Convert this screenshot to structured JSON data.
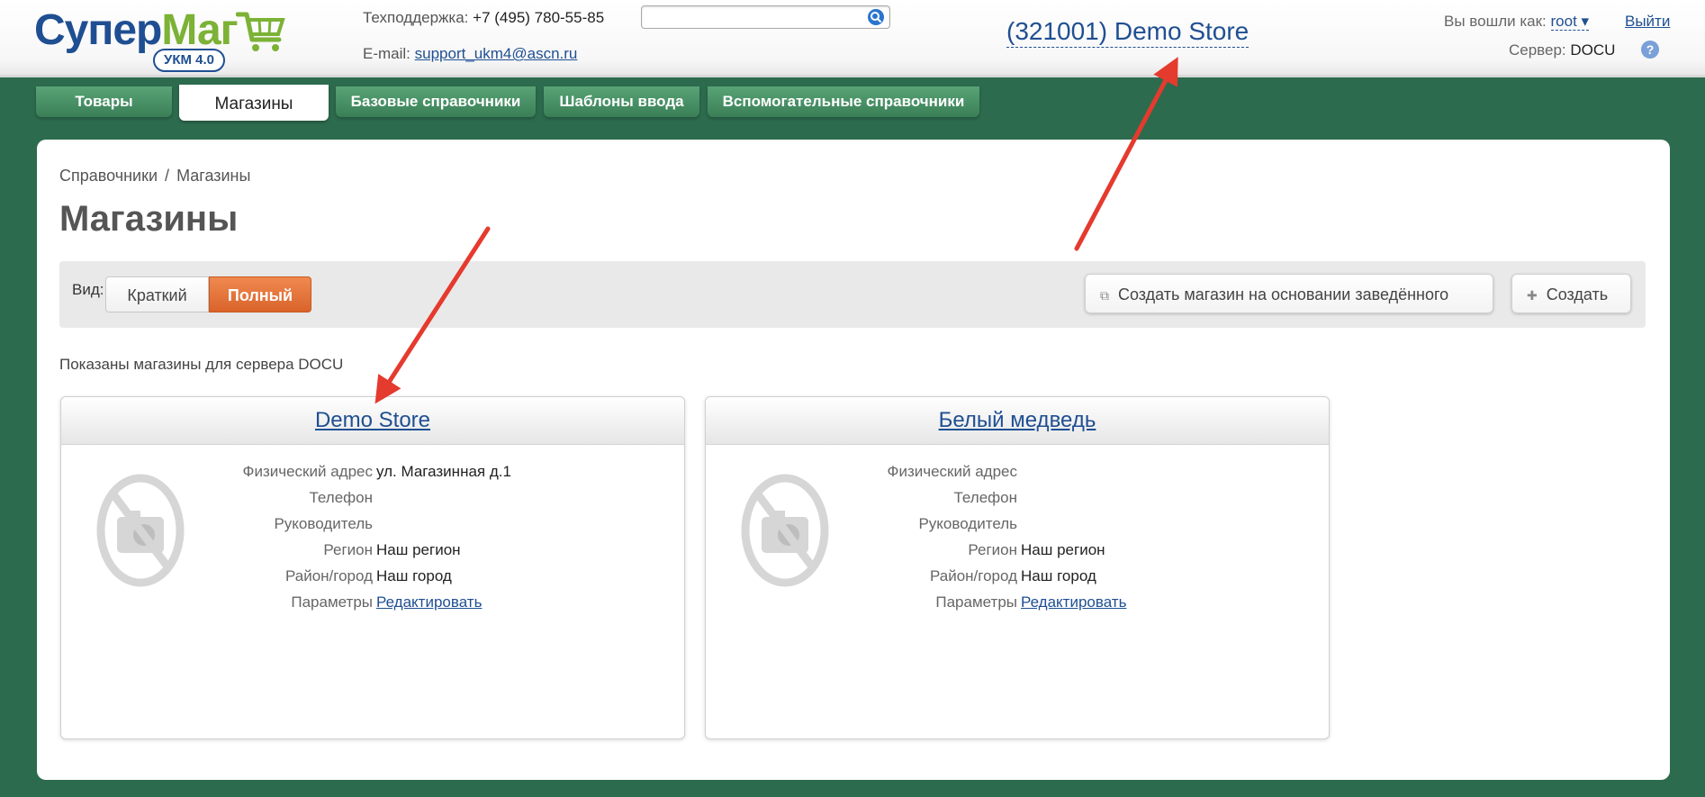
{
  "header": {
    "logo_part1": "Супер",
    "logo_part2": "Маг",
    "logo_badge": "УКМ 4.0",
    "support_label": "Техподдержка:",
    "support_phone": "+7 (495) 780-55-85",
    "email_label": "E-mail:",
    "email_value": "support_ukm4@ascn.ru",
    "search_value": "",
    "store_title": "(321001) Demo Store",
    "login_label": "Вы вошли как:",
    "login_user": "root",
    "logout_label": "Выйти",
    "server_label": "Сервер:",
    "server_value": "DOCU",
    "help_label": "?"
  },
  "tabs": [
    {
      "label": "Товары",
      "active": false
    },
    {
      "label": "Магазины",
      "active": true
    },
    {
      "label": "Базовые справочники",
      "active": false
    },
    {
      "label": "Шаблоны ввода",
      "active": false
    },
    {
      "label": "Вспомогательные справочники",
      "active": false
    }
  ],
  "breadcrumb": {
    "root": "Справочники",
    "separator": "/",
    "current": "Магазины"
  },
  "page_title": "Магазины",
  "toolbar": {
    "view_label": "Вид:",
    "view_short": "Краткий",
    "view_full": "Полный",
    "view_selected": "Полный",
    "copy_button": "Создать магазин на основании заведённого",
    "create_button": "Создать"
  },
  "shown_text": "Показаны магазины для сервера DOCU",
  "stores": [
    {
      "name": "Demo Store",
      "fields": [
        {
          "label": "Физический адрес",
          "value": "ул. Магазинная д.1"
        },
        {
          "label": "Телефон",
          "value": ""
        },
        {
          "label": "Руководитель",
          "value": ""
        },
        {
          "label": "Регион",
          "value": "Наш регион"
        },
        {
          "label": "Район/город",
          "value": "Наш город"
        },
        {
          "label": "Параметры",
          "value": "Редактировать",
          "link": true
        }
      ]
    },
    {
      "name": "Белый медведь",
      "fields": [
        {
          "label": "Физический адрес",
          "value": ""
        },
        {
          "label": "Телефон",
          "value": ""
        },
        {
          "label": "Руководитель",
          "value": ""
        },
        {
          "label": "Регион",
          "value": "Наш регион"
        },
        {
          "label": "Район/город",
          "value": "Наш город"
        },
        {
          "label": "Параметры",
          "value": "Редактировать",
          "link": true
        }
      ]
    }
  ],
  "colors": {
    "background": "#2d6b4e",
    "brand_blue": "#1f4f92",
    "brand_green": "#7cb235",
    "tab_green": "#3a7f57",
    "accent_orange": "#e06f36",
    "annotation_arrow": "#e53a2e"
  }
}
